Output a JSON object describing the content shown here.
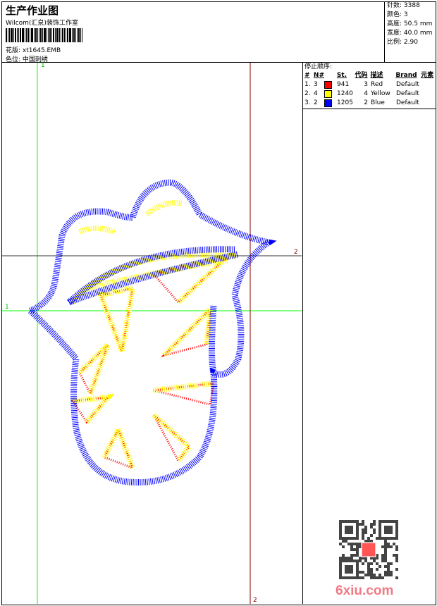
{
  "header": {
    "title": "生产作业图",
    "company": "Wilcom(汇泉)装饰工作室",
    "design_label": "花版:",
    "design_file": "xt1645.EMB",
    "colorway_label": "色位:",
    "colorway": "中国刺绣"
  },
  "stats": [
    {
      "label": "针数:",
      "value": "3388"
    },
    {
      "label": "颜色:",
      "value": "3"
    },
    {
      "label": "高度:",
      "value": "50.5 mm"
    },
    {
      "label": "宽度:",
      "value": "40.0 mm"
    },
    {
      "label": "比例:",
      "value": "2.90"
    }
  ],
  "stop_sequence": {
    "title": "停止顺序:",
    "headers": [
      "#",
      "N#",
      "St.",
      "代码",
      "描述",
      "Brand",
      "元素"
    ],
    "rows": [
      {
        "index": "1.",
        "needle": "3",
        "color": "#ff0000",
        "stitches": "941",
        "code": "3",
        "desc": "Red",
        "brand": "Default"
      },
      {
        "index": "2.",
        "needle": "4",
        "color": "#ffff00",
        "stitches": "1240",
        "code": "4",
        "desc": "Yellow",
        "brand": "Default"
      },
      {
        "index": "3.",
        "needle": "2",
        "color": "#0000ff",
        "stitches": "1205",
        "code": "2",
        "desc": "Blue",
        "brand": "Default"
      }
    ]
  },
  "guides": {
    "green_label": "1",
    "dark_label": "2"
  },
  "watermark": "6xiu.com",
  "colors": {
    "green_guide": "#00ff00",
    "dark_guide": "#800000",
    "red": "#ff0000",
    "yellow": "#ffff00",
    "blue": "#0000ff"
  }
}
